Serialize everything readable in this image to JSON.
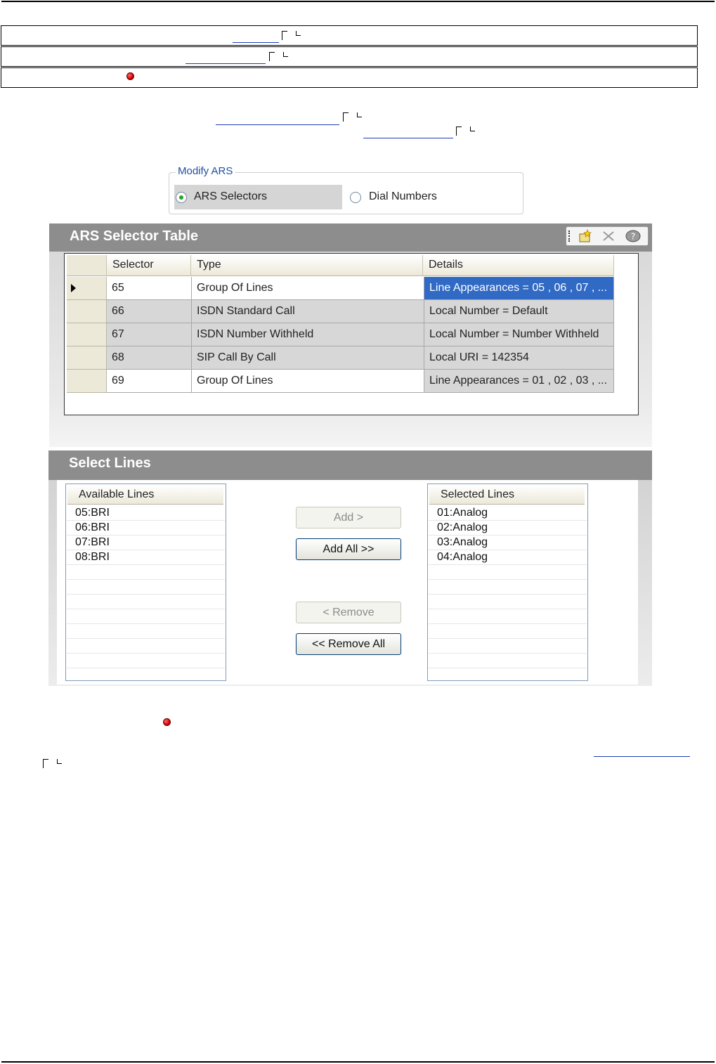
{
  "modify_ars": {
    "title": "Modify ARS",
    "options": [
      "ARS Selectors",
      "Dial Numbers"
    ]
  },
  "selector_table": {
    "title": "ARS Selector Table",
    "columns": [
      "Selector",
      "Type",
      "Details"
    ],
    "rows": [
      {
        "selector": "65",
        "type": "Group Of Lines",
        "details": "Line Appearances = 05 , 06 , 07 , ..."
      },
      {
        "selector": "66",
        "type": "ISDN Standard Call",
        "details": "Local Number = Default"
      },
      {
        "selector": "67",
        "type": "ISDN Number Withheld",
        "details": "Local Number = Number Withheld"
      },
      {
        "selector": "68",
        "type": "SIP Call By Call",
        "details": "Local URI = 142354"
      },
      {
        "selector": "69",
        "type": "Group Of Lines",
        "details": "Line Appearances = 01 , 02 , 03 , ..."
      }
    ]
  },
  "select_lines": {
    "title": "Select Lines",
    "available_header": "Available Lines",
    "available": [
      "05:BRI",
      "06:BRI",
      "07:BRI",
      "08:BRI"
    ],
    "selected_header": "Selected Lines",
    "selected": [
      "01:Analog",
      "02:Analog",
      "03:Analog",
      "04:Analog"
    ],
    "buttons": {
      "add": "Add >",
      "add_all": "Add All >>",
      "remove": "< Remove",
      "remove_all": "<< Remove All"
    }
  },
  "colors": {
    "selection": "#316ac5",
    "panel_header": "#8d8d8d",
    "group_title": "#2050a0"
  },
  "icons": [
    "new-item-icon",
    "delete-icon",
    "help-icon"
  ]
}
